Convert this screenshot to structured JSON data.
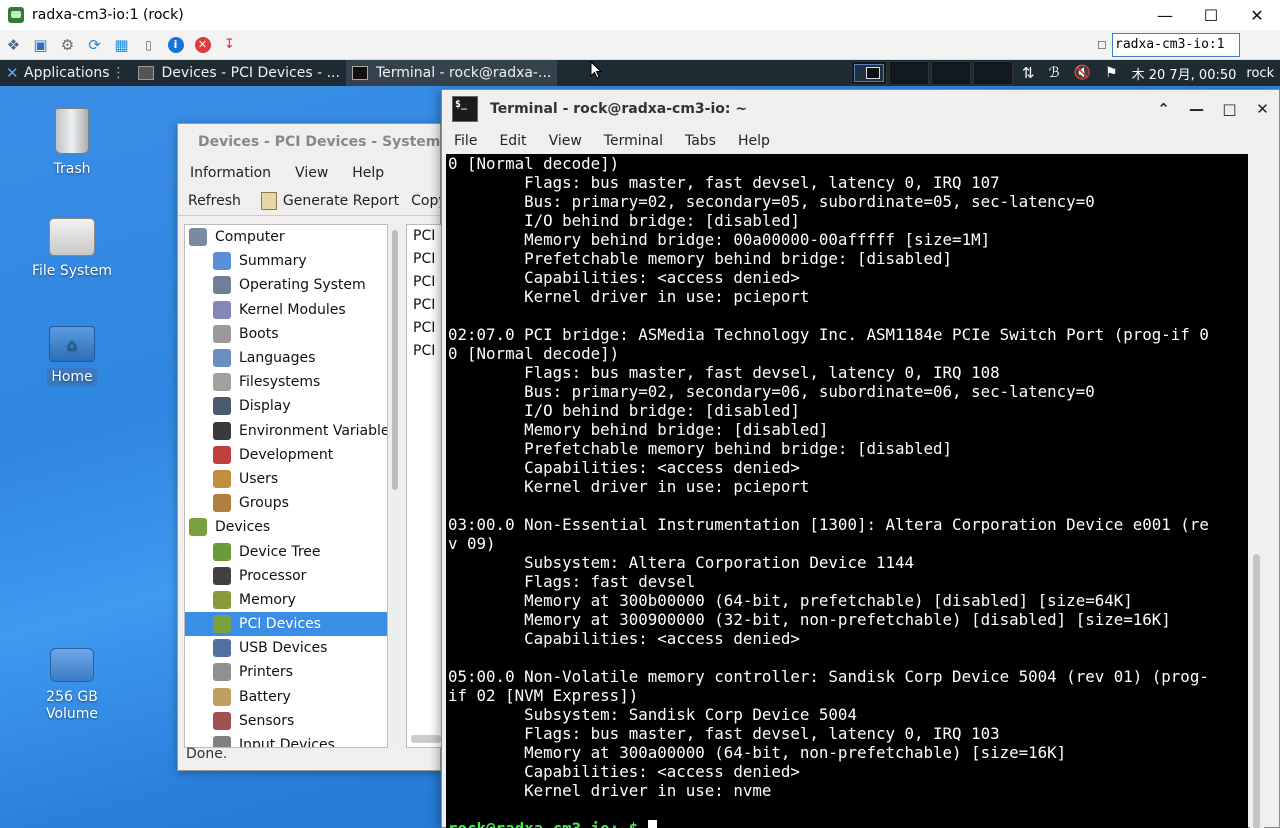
{
  "vnc": {
    "title": "radxa-cm3-io:1 (rock)",
    "host_field": "radxa-cm3-io:1",
    "toolbar_icons": [
      "options-icon",
      "fullscreen-icon",
      "settings-icon",
      "refresh-icon",
      "windows-key-icon",
      "ctrl-alt-del-icon",
      "info-icon",
      "disconnect-icon",
      "file-transfer-icon"
    ]
  },
  "panel": {
    "applications": "Applications",
    "tasks": [
      {
        "label": "Devices - PCI Devices - ..."
      },
      {
        "label": "Terminal - rock@radxa-..."
      }
    ],
    "clock": "木 20  7月, 00:50",
    "user": "rock"
  },
  "desktop_icons": [
    {
      "label": "Trash"
    },
    {
      "label": "File System"
    },
    {
      "label": "Home"
    },
    {
      "label": "256 GB\nVolume"
    }
  ],
  "sysinfo": {
    "title": "Devices - PCI Devices - System I",
    "menu": [
      "Information",
      "View",
      "Help"
    ],
    "toolbar": {
      "refresh": "Refresh",
      "generate_report": "Generate Report",
      "copy": "Copy"
    },
    "tree": [
      {
        "label": "Computer",
        "level": "cat",
        "color": "#7a8aa0"
      },
      {
        "label": "Summary",
        "level": "sub",
        "color": "#5b8fd6"
      },
      {
        "label": "Operating System",
        "level": "sub",
        "color": "#6f7f96"
      },
      {
        "label": "Kernel Modules",
        "level": "sub",
        "color": "#8686b8"
      },
      {
        "label": "Boots",
        "level": "sub",
        "color": "#9a9a9a"
      },
      {
        "label": "Languages",
        "level": "sub",
        "color": "#6b8fc0"
      },
      {
        "label": "Filesystems",
        "level": "sub",
        "color": "#a0a0a0"
      },
      {
        "label": "Display",
        "level": "sub",
        "color": "#4a5a70"
      },
      {
        "label": "Environment Variables",
        "level": "sub",
        "color": "#3a3a3a"
      },
      {
        "label": "Development",
        "level": "sub",
        "color": "#c04040"
      },
      {
        "label": "Users",
        "level": "sub",
        "color": "#c09040"
      },
      {
        "label": "Groups",
        "level": "sub",
        "color": "#b08040"
      },
      {
        "label": "Devices",
        "level": "cat",
        "color": "#7aa040"
      },
      {
        "label": "Device Tree",
        "level": "sub",
        "color": "#6a9a3a"
      },
      {
        "label": "Processor",
        "level": "sub",
        "color": "#404040"
      },
      {
        "label": "Memory",
        "level": "sub",
        "color": "#8a9a3a"
      },
      {
        "label": "PCI Devices",
        "level": "sub",
        "color": "#7aa040",
        "selected": true
      },
      {
        "label": "USB Devices",
        "level": "sub",
        "color": "#5070a0"
      },
      {
        "label": "Printers",
        "level": "sub",
        "color": "#909090"
      },
      {
        "label": "Battery",
        "level": "sub",
        "color": "#c0a060"
      },
      {
        "label": "Sensors",
        "level": "sub",
        "color": "#a05050"
      },
      {
        "label": "Input Devices",
        "level": "sub",
        "color": "#808080"
      }
    ],
    "list_rows": [
      "PCI",
      "PCI",
      "PCI",
      "PCI",
      "PCI",
      "PCI"
    ],
    "status": "Done."
  },
  "terminal": {
    "title": "Terminal - rock@radxa-cm3-io: ~",
    "menu": [
      "File",
      "Edit",
      "View",
      "Terminal",
      "Tabs",
      "Help"
    ],
    "lines": [
      "0 [Normal decode])",
      "        Flags: bus master, fast devsel, latency 0, IRQ 107",
      "        Bus: primary=02, secondary=05, subordinate=05, sec-latency=0",
      "        I/O behind bridge: [disabled]",
      "        Memory behind bridge: 00a00000-00afffff [size=1M]",
      "        Prefetchable memory behind bridge: [disabled]",
      "        Capabilities: <access denied>",
      "        Kernel driver in use: pcieport",
      "",
      "02:07.0 PCI bridge: ASMedia Technology Inc. ASM1184e PCIe Switch Port (prog-if 0",
      "0 [Normal decode])",
      "        Flags: bus master, fast devsel, latency 0, IRQ 108",
      "        Bus: primary=02, secondary=06, subordinate=06, sec-latency=0",
      "        I/O behind bridge: [disabled]",
      "        Memory behind bridge: [disabled]",
      "        Prefetchable memory behind bridge: [disabled]",
      "        Capabilities: <access denied>",
      "        Kernel driver in use: pcieport",
      "",
      "03:00.0 Non-Essential Instrumentation [1300]: Altera Corporation Device e001 (re",
      "v 09)",
      "        Subsystem: Altera Corporation Device 1144",
      "        Flags: fast devsel",
      "        Memory at 300b00000 (64-bit, prefetchable) [disabled] [size=64K]",
      "        Memory at 300900000 (32-bit, non-prefetchable) [disabled] [size=16K]",
      "        Capabilities: <access denied>",
      "",
      "05:00.0 Non-Volatile memory controller: Sandisk Corp Device 5004 (rev 01) (prog-",
      "if 02 [NVM Express])",
      "        Subsystem: Sandisk Corp Device 5004",
      "        Flags: bus master, fast devsel, latency 0, IRQ 103",
      "        Memory at 300a00000 (64-bit, non-prefetchable) [size=16K]",
      "        Capabilities: <access denied>",
      "        Kernel driver in use: nvme",
      ""
    ],
    "prompt": "rock@radxa-cm3-io:~$ "
  }
}
